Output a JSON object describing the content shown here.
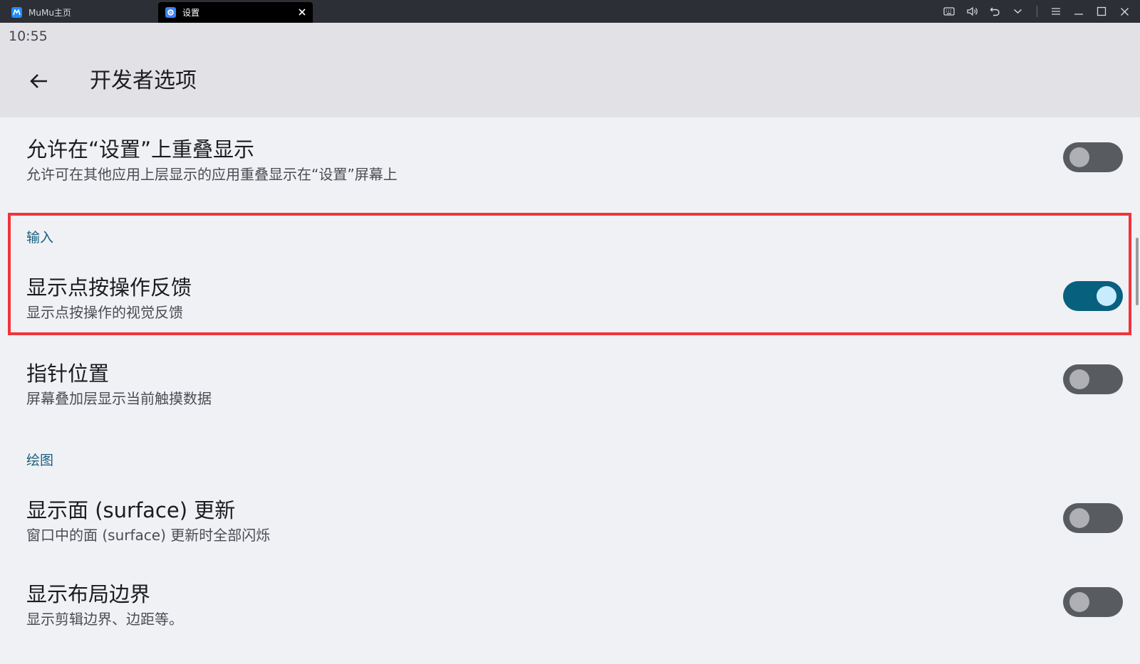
{
  "window": {
    "tabs": [
      {
        "label": "MuMu主页",
        "active": false
      },
      {
        "label": "设置",
        "active": true
      }
    ]
  },
  "status_bar": {
    "time": "10:55"
  },
  "header": {
    "title": "开发者选项"
  },
  "settings": {
    "overlay": {
      "title": "允许在“设置”上重叠显示",
      "subtitle": "允许可在其他应用上层显示的应用重叠显示在“设置”屏幕上",
      "enabled": false
    },
    "section_input": "输入",
    "show_taps": {
      "title": "显示点按操作反馈",
      "subtitle": "显示点按操作的视觉反馈",
      "enabled": true
    },
    "pointer_location": {
      "title": "指针位置",
      "subtitle": "屏幕叠加层显示当前触摸数据",
      "enabled": false
    },
    "section_drawing": "绘图",
    "surface_updates": {
      "title": "显示面 (surface) 更新",
      "subtitle": "窗口中的面 (surface) 更新时全部闪烁",
      "enabled": false
    },
    "layout_bounds": {
      "title": "显示布局边界",
      "subtitle": "显示剪辑边界、边距等。",
      "enabled": false
    }
  },
  "colors": {
    "accent": "#08607f",
    "section_label": "#175f7d",
    "highlight": "#f2333a"
  }
}
